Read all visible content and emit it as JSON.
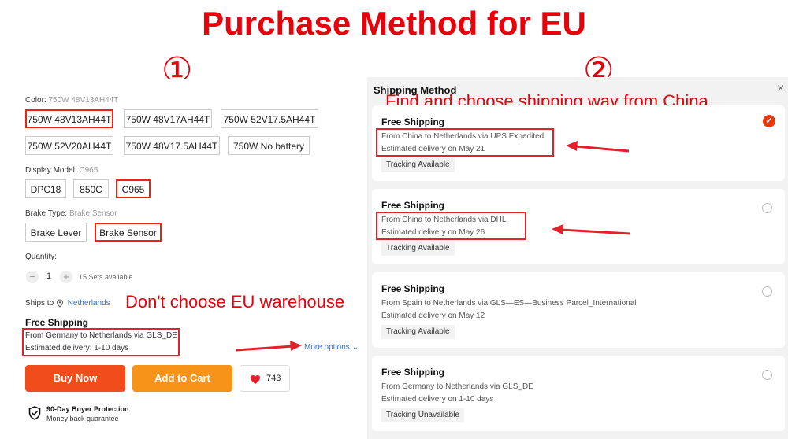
{
  "title": "Purchase Method for EU",
  "steps": {
    "one": "①",
    "two": "②"
  },
  "left": {
    "color_label": "Color:",
    "color_value": "750W 48V13AH44T",
    "color_options": [
      "750W 48V13AH44T",
      "750W 48V17AH44T",
      "750W 52V17.5AH44T",
      "750W 52V20AH44T",
      "750W 48V17.5AH44T",
      "750W No battery"
    ],
    "display_label": "Display Model:",
    "display_value": "C965",
    "display_options": [
      "DPC18",
      "850C",
      "C965"
    ],
    "brake_label": "Brake Type:",
    "brake_value": "Brake Sensor",
    "brake_options": [
      "Brake Lever",
      "Brake Sensor"
    ],
    "quantity_label": "Quantity:",
    "quantity_minus": "−",
    "quantity_value": "1",
    "quantity_plus": "+",
    "quantity_avail": "15 Sets available",
    "ships_to_label": "Ships to",
    "ships_to_value": "Netherlands",
    "annotation": "Don't choose EU warehouse",
    "shipping_title": "Free Shipping",
    "shipping_from": "From Germany to Netherlands via GLS_DE",
    "shipping_delivery": "Estimated delivery: 1-10 days",
    "more_options": "More options",
    "buy_now": "Buy Now",
    "add_to_cart": "Add to Cart",
    "wishlist_count": "743",
    "protection_title": "90-Day Buyer Protection",
    "protection_sub": "Money back guarantee"
  },
  "right": {
    "heading": "Shipping Method",
    "annotation": "Find and choose shipping way from China",
    "close": "×",
    "cards": [
      {
        "title": "Free Shipping",
        "from": "From China to Netherlands via UPS Expedited",
        "delivery": "Estimated delivery on May 21",
        "tracking": "Tracking Available",
        "selected": true
      },
      {
        "title": "Free Shipping",
        "from": "From China to Netherlands via DHL",
        "delivery": "Estimated delivery on May 26",
        "tracking": "Tracking Available",
        "selected": false
      },
      {
        "title": "Free Shipping",
        "from": "From Spain to Netherlands via GLS—ES—Business Parcel_International",
        "delivery": "Estimated delivery on May 12",
        "tracking": "Tracking Available",
        "selected": false
      },
      {
        "title": "Free Shipping",
        "from": "From Germany to Netherlands via GLS_DE",
        "delivery": "Estimated delivery on 1-10 days",
        "tracking": "Tracking Unavailable",
        "selected": false
      }
    ]
  },
  "colors": {
    "accent_red": "#e8000b",
    "buy_now": "#f04c1c",
    "add_to_cart": "#f8931a",
    "link_blue": "#2b6fd8",
    "selected_check": "#e8380d"
  },
  "icons": [
    "location-pin-icon",
    "heart-icon",
    "shield-check-icon",
    "chevron-down-icon",
    "checkmark-icon",
    "close-icon"
  ]
}
